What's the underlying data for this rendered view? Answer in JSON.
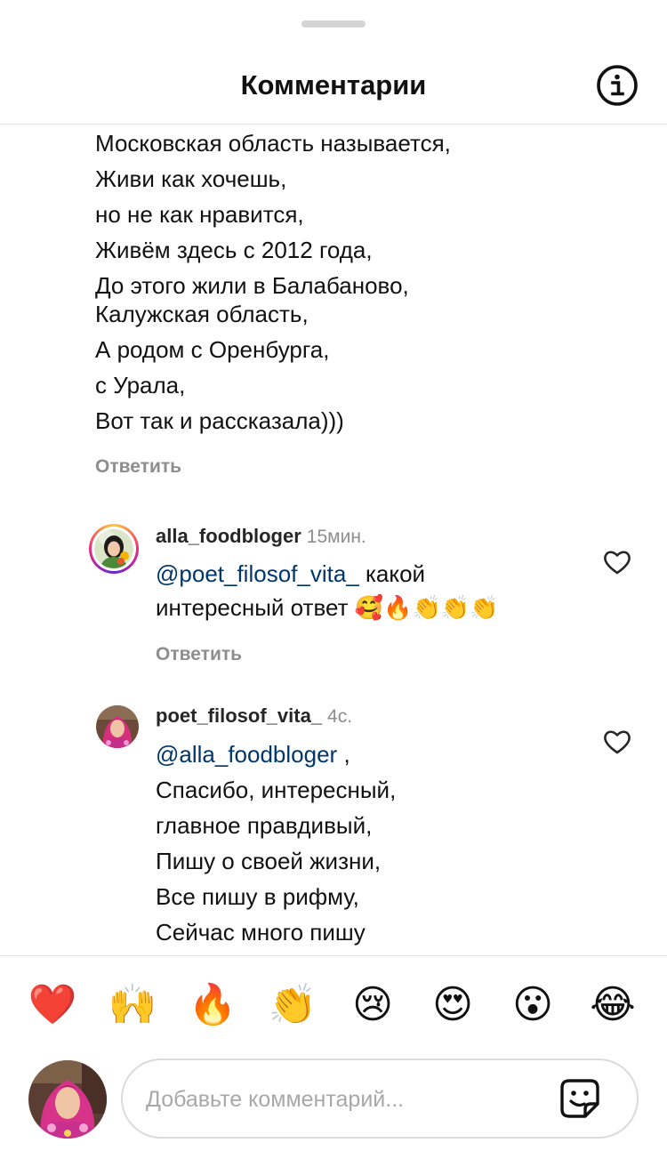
{
  "header": {
    "title": "Комментарии",
    "info_icon": "info-circle-icon"
  },
  "continued_comment": {
    "lines": [
      "Московская область называется,",
      "Живи как хочешь,",
      "но не как нравится,",
      "Живём здесь с 2012 года,",
      "До этого жили в Балабаново,",
      "Калужская область,",
      "А родом с Оренбурга,",
      "с Урала,",
      "Вот так и рассказала)))"
    ],
    "reply_label": "Ответить"
  },
  "comments": [
    {
      "username": "alla_foodbloger",
      "time": "15мин.",
      "mention": "@poet_filosof_vita_",
      "text_after_mention": " какой",
      "line2": "интересный ответ 🥰🔥👏👏👏",
      "reply_label": "Ответить",
      "like_icon": "heart-outline-icon"
    },
    {
      "username": "poet_filosof_vita_",
      "time": "4с.",
      "mention": "@alla_foodbloger",
      "text_after_mention": " ,",
      "lines": [
        "Спасибо, интересный,",
        "главное правдивый,",
        "Пишу о своей жизни,",
        "Все пишу в рифму,",
        "Сейчас много пишу"
      ],
      "like_icon": "heart-outline-icon"
    }
  ],
  "emoji_bar": [
    "❤️",
    "🙌",
    "🔥",
    "👏",
    "😢",
    "😍",
    "😮",
    "😂"
  ],
  "composer": {
    "placeholder": "Добавьте комментарий...",
    "sticker_icon": "sticker-icon"
  },
  "colors": {
    "mention": "#00376b",
    "meta_gray": "#8e8e8e",
    "divider": "#e3e3e3"
  }
}
